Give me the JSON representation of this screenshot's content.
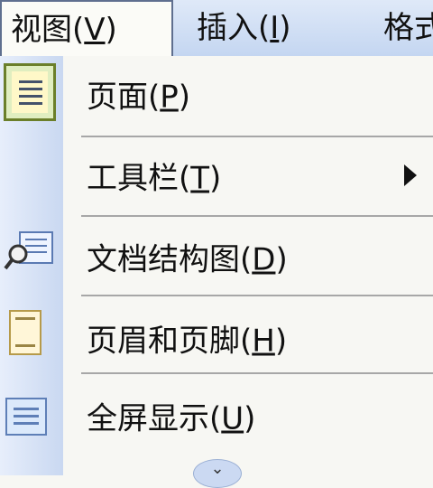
{
  "menubar": {
    "view": {
      "label": "视图",
      "mnemonic": "V"
    },
    "insert": {
      "label": "插入",
      "mnemonic": "I"
    },
    "format": {
      "label": "格式"
    }
  },
  "menu": {
    "items": [
      {
        "label": "页面",
        "mnemonic": "P",
        "icon": "page-view-icon"
      },
      {
        "label": "工具栏",
        "mnemonic": "T",
        "submenu": true
      },
      {
        "label": "文档结构图",
        "mnemonic": "D",
        "icon": "document-map-icon"
      },
      {
        "label": "页眉和页脚",
        "mnemonic": "H",
        "icon": "header-footer-icon"
      },
      {
        "label": "全屏显示",
        "mnemonic": "U",
        "icon": "full-screen-icon"
      }
    ],
    "expand_glyph": "⌄"
  },
  "colors": {
    "menubar_bg": "#c4d6f1",
    "icon_strip_bg": "#d6e2f6",
    "menu_bg": "#f7f7f3",
    "separator": "#a7a7a7"
  }
}
